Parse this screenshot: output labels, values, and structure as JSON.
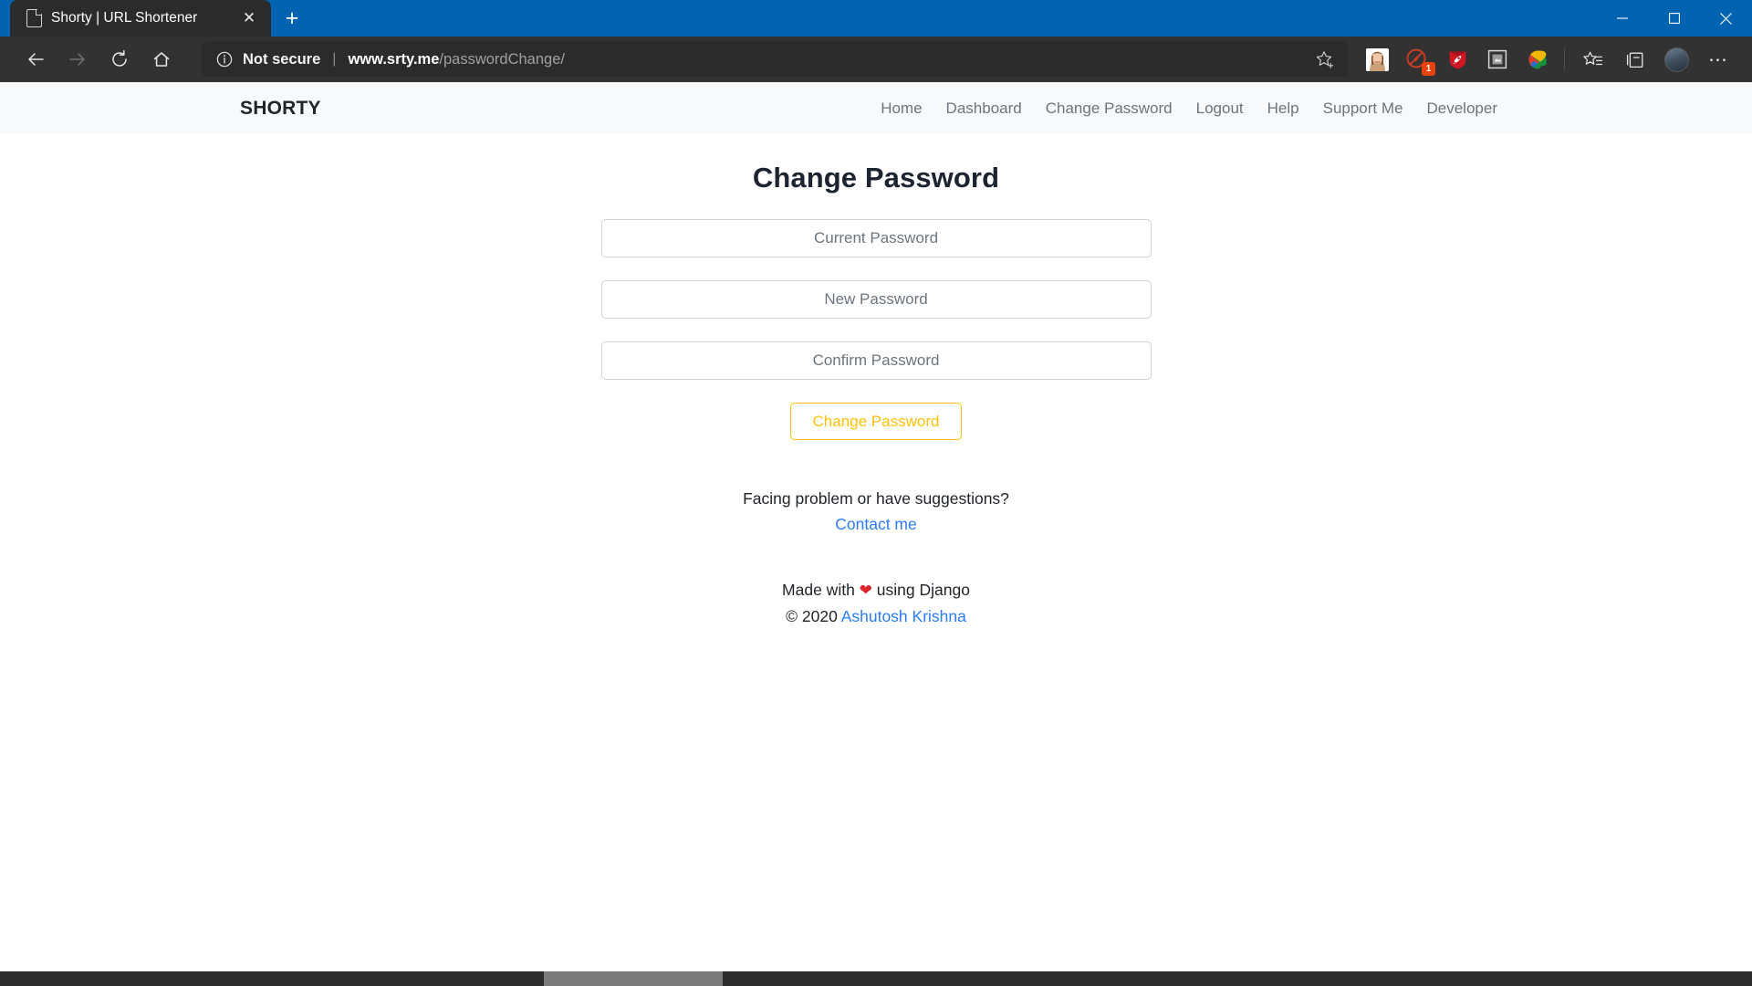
{
  "browser": {
    "tab": {
      "title": "Shorty | URL Shortener",
      "favicon_icon": "document-icon",
      "close_icon": "✕"
    },
    "new_tab_label": "+",
    "window_controls": {
      "minimize_icon": "minimize-icon",
      "maximize_icon": "maximize-icon",
      "close_icon": "close-icon"
    },
    "nav": {
      "back_icon": "back-arrow-icon",
      "forward_icon": "forward-arrow-icon",
      "reload_icon": "reload-icon",
      "home_icon": "home-icon"
    },
    "address_bar": {
      "info_icon": "info-circle-icon",
      "security_label": "Not secure",
      "separator": "|",
      "url_host": "www.srty.me",
      "url_path": "/passwordChange/",
      "favorite_icon": "add-favorite-star-icon"
    },
    "extensions": [
      {
        "name": "profile-avatar-extension",
        "icon": "avatar-image-icon",
        "badge": ""
      },
      {
        "name": "adblock-extension",
        "icon": "adblock-icon",
        "badge": "1"
      },
      {
        "name": "shield-rocket-extension",
        "icon": "shield-rocket-icon",
        "badge": ""
      },
      {
        "name": "screenshot-extension",
        "icon": "frame-icon",
        "badge": ""
      },
      {
        "name": "color-picker-extension",
        "icon": "palette-icon",
        "badge": ""
      }
    ],
    "collections_icon": "collections-icon",
    "favorites_icon": "favorites-list-icon",
    "profile_icon": "user-profile-icon",
    "settings_more_label": "⋯"
  },
  "site": {
    "brand": "SHORTY",
    "nav_links": [
      {
        "label": "Home"
      },
      {
        "label": "Dashboard"
      },
      {
        "label": "Change Password"
      },
      {
        "label": "Logout"
      },
      {
        "label": "Help"
      },
      {
        "label": "Support Me"
      },
      {
        "label": "Developer"
      }
    ],
    "page_title": "Change Password",
    "form": {
      "current_password": {
        "value": "",
        "placeholder": "Current Password"
      },
      "new_password": {
        "value": "",
        "placeholder": "New Password"
      },
      "confirm_password": {
        "value": "",
        "placeholder": "Confirm Password"
      },
      "submit_label": "Change Password"
    },
    "footer": {
      "question": "Facing problem or have suggestions?",
      "contact_link": "Contact me",
      "made_prefix": "Made with ",
      "heart": "❤",
      "made_suffix": " using Django",
      "copyright": "© 2020 ",
      "author": "Ashutosh Krishna"
    }
  },
  "colors": {
    "titlebar_blue": "#0063b1",
    "toolbar_dark": "#323232",
    "accent_amber": "#ffc107",
    "link_blue": "#2b7cf7",
    "muted_text": "#6c757d",
    "navbar_bg": "#f8f9fa"
  }
}
